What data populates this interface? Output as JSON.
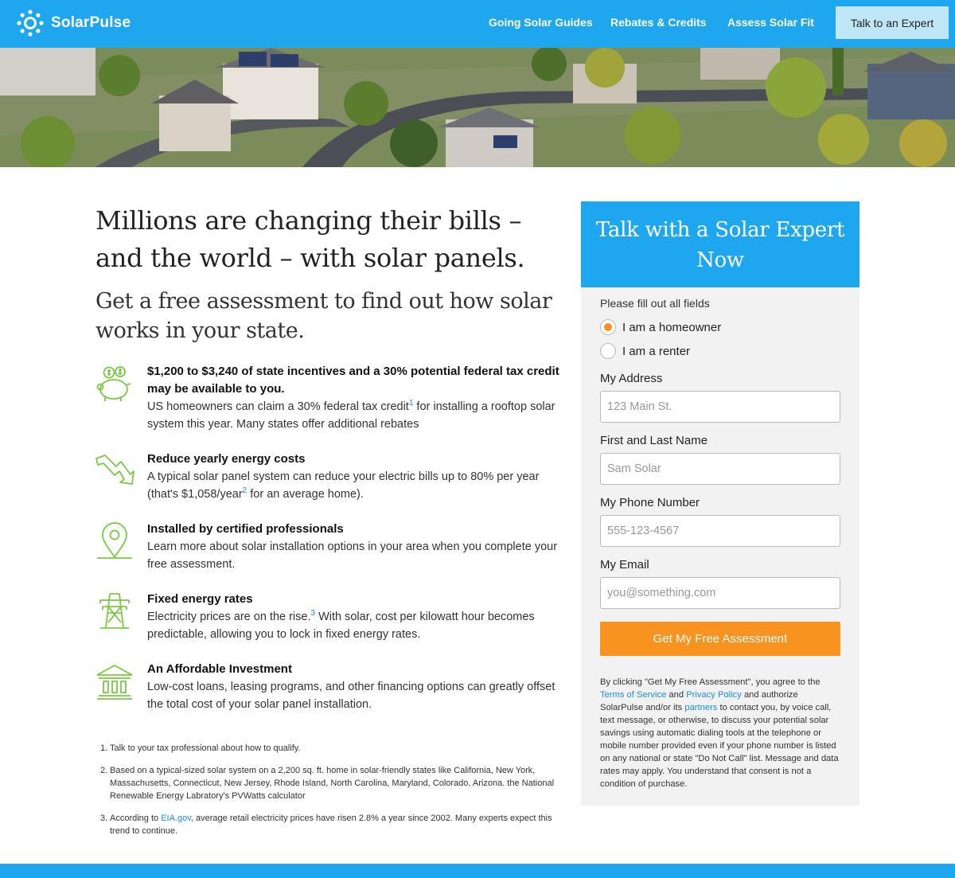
{
  "brand": {
    "name": "SolarPulse",
    "logo_icon": "sun-icon"
  },
  "nav": {
    "links": [
      "Going Solar Guides",
      "Rebates & Credits",
      "Assess Solar Fit"
    ],
    "cta": "Talk to an Expert"
  },
  "hero": {
    "image": "aerial-neighborhood-solar-rooftops"
  },
  "main": {
    "headline": "Millions are changing their bills – and the world – with solar panels.",
    "subhead": "Get a free assessment to find out how solar works in your state.",
    "features": [
      {
        "icon": "piggy-bank-icon",
        "title": "$1,200 to $3,240 of state incentives and a 30% potential federal tax credit may be available to you.",
        "text_a": "US homeowners can claim a 30% federal tax credit",
        "sup": "1",
        "text_b": " for installing a rooftop solar system this year. Many states offer additional rebates"
      },
      {
        "icon": "trend-down-arrow-icon",
        "title": "Reduce yearly energy costs",
        "text_a": "A typical solar panel system can reduce your electric bills up to 80% per year (that's $1,058/year",
        "sup": "2",
        "text_b": " for an average home)."
      },
      {
        "icon": "map-pin-icon",
        "title": "Installed by certified professionals",
        "text_a": "Learn more about solar installation options in your area when you complete your free assessment.",
        "sup": "",
        "text_b": ""
      },
      {
        "icon": "power-tower-icon",
        "title": "Fixed energy rates",
        "text_a": "Electricity prices are on the rise.",
        "sup": "3",
        "text_b": " With solar, cost per kilowatt hour becomes predictable, allowing you to lock in fixed energy rates."
      },
      {
        "icon": "bank-icon",
        "title": "An Affordable Investment",
        "text_a": "Low-cost loans, leasing programs, and other financing options can greatly offset the total cost of your solar panel installation.",
        "sup": "",
        "text_b": ""
      }
    ],
    "footnotes": [
      {
        "num": "1.",
        "text": "Talk to your tax professional about how to qualify."
      },
      {
        "num": "2.",
        "text": "Based on a typical-sized solar system on a 2,200 sq. ft. home in solar-friendly states like California, New York, Massachusetts, Connecticut, New Jersey, Rhode Island, North Carolina, Maryland, Colorado, Arizona. the National Renewable Energy Labratory's PVWatts calculator"
      },
      {
        "num": "3.",
        "text_a": "According to ",
        "link": "EIA.gov",
        "text_b": ", average retail electricity prices have risen 2.8% a year since 2002. Many experts expect this trend to continue."
      }
    ]
  },
  "form": {
    "title": "Talk with a Solar Expert Now",
    "note": "Please fill out all fields",
    "radios": [
      {
        "label": "I am a homeowner",
        "checked": true
      },
      {
        "label": "I am a renter",
        "checked": false
      }
    ],
    "fields": [
      {
        "label": "My Address",
        "placeholder": "123 Main St."
      },
      {
        "label": "First and Last Name",
        "placeholder": "Sam Solar"
      },
      {
        "label": "My Phone Number",
        "placeholder": "555-123-4567"
      },
      {
        "label": "My Email",
        "placeholder": "you@something.com"
      }
    ],
    "submit": "Get My Free Assessment",
    "legal": {
      "p1": "By clicking \"Get My Free Assessment\", you agree to the ",
      "terms": "Terms of Service",
      "p2": " and ",
      "privacy": "Privacy Policy",
      "p3": " and authorize SolarPulse and/or its ",
      "partners": "partners",
      "p4": " to contact you, by voice call, text message, or otherwise, to discuss your potential solar savings using automatic dialing tools at the telephone or mobile number provided even if your phone number is listed on any national or state \"Do Not Call\" list. Message and data rates may apply. You understand that consent is not a condition of purchase."
    }
  },
  "colors": {
    "brand_blue": "#1ea7ee",
    "accent_orange": "#f7931e",
    "icon_green": "#7ac943",
    "link_blue": "#1a8fd6"
  }
}
